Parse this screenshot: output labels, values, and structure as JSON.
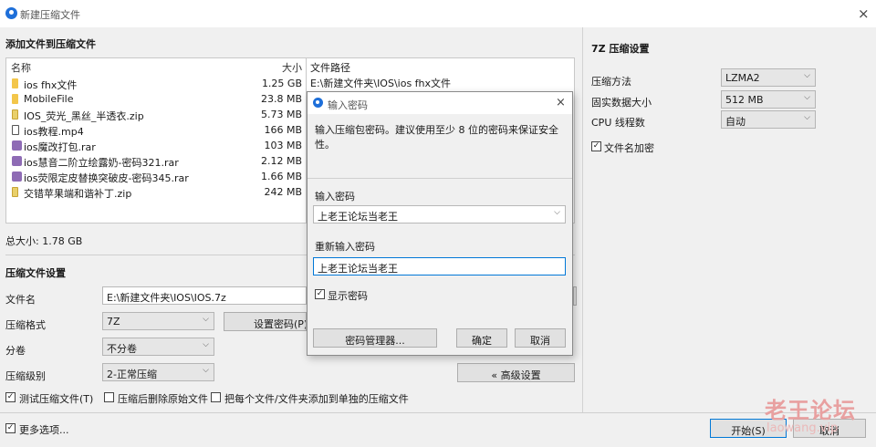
{
  "window": {
    "title": "新建压缩文件",
    "close_icon": "×"
  },
  "files_section": {
    "title": "添加文件到压缩文件",
    "columns": {
      "name": "名称",
      "size": "大小",
      "path": "文件路径"
    },
    "rows": [
      {
        "icon": "folder",
        "name": "ios fhx文件",
        "size": "1.25 GB",
        "path": "E:\\新建文件夹\\IOS\\ios fhx文件"
      },
      {
        "icon": "folder",
        "name": "MobileFile",
        "size": "23.8 MB",
        "path": ""
      },
      {
        "icon": "zip",
        "name": "IOS_荧光_黑丝_半透衣.zip",
        "size": "5.73 MB",
        "path": ""
      },
      {
        "icon": "mp4",
        "name": "ios教程.mp4",
        "size": "166 MB",
        "path": ""
      },
      {
        "icon": "rar",
        "name": "ios魔改打包.rar",
        "size": "103 MB",
        "path": ""
      },
      {
        "icon": "rar",
        "name": "ios慧音二阶立绘露奶-密码321.rar",
        "size": "2.12 MB",
        "path": ""
      },
      {
        "icon": "rar",
        "name": "ios荧限定皮替换突破皮-密码345.rar",
        "size": "1.66 MB",
        "path": ""
      },
      {
        "icon": "zip",
        "name": "交错苹果端和谐补丁.zip",
        "size": "242 MB",
        "path": ""
      }
    ],
    "total": "总大小: 1.78 GB"
  },
  "compress_settings": {
    "title": "压缩文件设置",
    "filename_label": "文件名",
    "filename_value": "E:\\新建文件夹\\IOS\\IOS.7z",
    "format_label": "压缩格式",
    "format_value": "7Z",
    "set_password_button": "设置密码(P)...",
    "split_label": "分卷",
    "split_value": "不分卷",
    "level_label": "压缩级别",
    "level_value": "2-正常压缩",
    "advanced_button": "« 高级设置",
    "test_checkbox": "测试压缩文件(T)",
    "delete_checkbox": "压缩后删除原始文件",
    "separate_checkbox": "把每个文件/文件夹添加到单独的压缩文件",
    "more_options": "更多选项...",
    "start_button": "开始(S)",
    "cancel_button": "取消"
  },
  "sevenz_settings": {
    "title": "7Z 压缩设置",
    "method_label": "压缩方法",
    "method_value": "LZMA2",
    "solid_label": "固实数据大小",
    "solid_value": "512 MB",
    "cpu_label": "CPU 线程数",
    "cpu_value": "自动",
    "encrypt_names": "文件名加密"
  },
  "password_dialog": {
    "title": "输入密码",
    "instruction": "输入压缩包密码。建议使用至少 8 位的密码来保证安全性。",
    "password_label": "输入密码",
    "password_value": "上老王论坛当老王",
    "repeat_label": "重新输入密码",
    "repeat_value": "上老王论坛当老王",
    "show_password": "显示密码",
    "manager_button": "密码管理器...",
    "ok_button": "确定",
    "cancel_button": "取消"
  },
  "watermark": {
    "text": "老王论坛",
    "url": "laowang.vip"
  },
  "colors": {
    "accent": "#1e6fd9",
    "rar_icon": "#8e6bb5",
    "folder_icon": "#f3c64a",
    "watermark": "#e8a0a0"
  }
}
